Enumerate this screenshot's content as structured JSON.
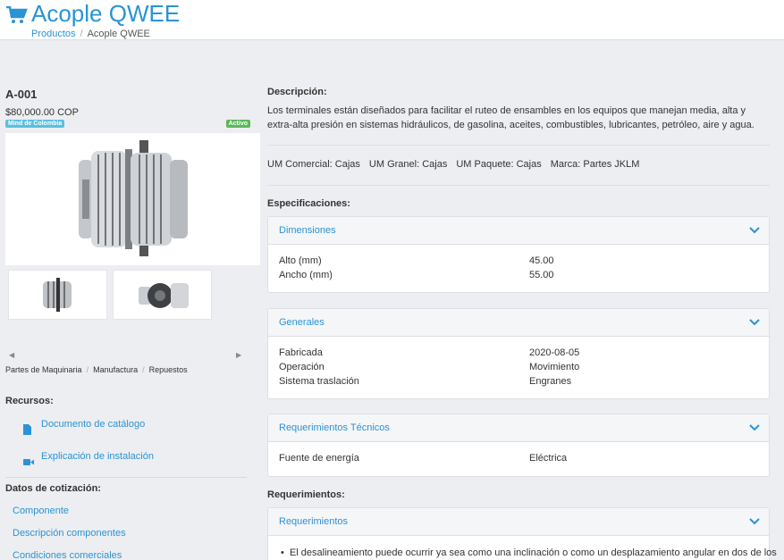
{
  "header": {
    "title": "Acople QWEE",
    "breadcrumb": {
      "root": "Productos",
      "current": "Acople QWEE"
    },
    "icon": "shopping-cart-icon"
  },
  "product": {
    "sku": "A-001",
    "price": "$80,000.00 COP",
    "brand_badge": "Mind de Colombia",
    "status_badge": "Activo",
    "categories": [
      "Partes de Maquinaria",
      "Manufactura",
      "Repuestos"
    ]
  },
  "resources": {
    "title": "Recursos:",
    "items": [
      {
        "label": "Documento de catálogo",
        "icon": "document-icon"
      },
      {
        "label": "Explicación de instalación",
        "icon": "video-icon"
      }
    ]
  },
  "quote": {
    "title": "Datos de cotización:",
    "items": [
      "Componente",
      "Descripción componentes",
      "Condiciones comerciales"
    ]
  },
  "description": {
    "label": "Descripción:",
    "text": "Los terminales están diseñados para facilitar el ruteo de ensambles en los equipos que manejan media, alta y extra-alta presión en sistemas hidráulicos, de gasolina, aceites, combustibles, lubricantes, petróleo, aire y agua."
  },
  "um": {
    "comercial": "UM Comercial: Cajas",
    "granel": "UM Granel: Cajas",
    "paquete": "UM Paquete: Cajas",
    "marca": "Marca: Partes JKLM"
  },
  "specs": {
    "label": "Especificaciones:",
    "panels": [
      {
        "title": "Dimensiones",
        "rows": [
          {
            "k": "Alto (mm)",
            "v": "45.00"
          },
          {
            "k": "Ancho (mm)",
            "v": "55.00"
          }
        ]
      },
      {
        "title": "Generales",
        "rows": [
          {
            "k": "Fabricada",
            "v": "2020-08-05"
          },
          {
            "k": "Operación",
            "v": "Movimiento"
          },
          {
            "k": "Sistema traslación",
            "v": "Engranes"
          }
        ]
      },
      {
        "title": "Requerimientos Técnicos",
        "rows": [
          {
            "k": "Fuente de energía",
            "v": "Eléctrica"
          }
        ]
      }
    ]
  },
  "requirements": {
    "label": "Requerimientos:",
    "panel_title": "Requerimientos",
    "bullet": "El desalineamiento puede ocurrir ya sea como una inclinación o como un desplazamiento angular en dos de los"
  },
  "colors": {
    "accent": "#2a93d5",
    "active": "#5cb85c",
    "brand_badge": "#5bc0de"
  }
}
